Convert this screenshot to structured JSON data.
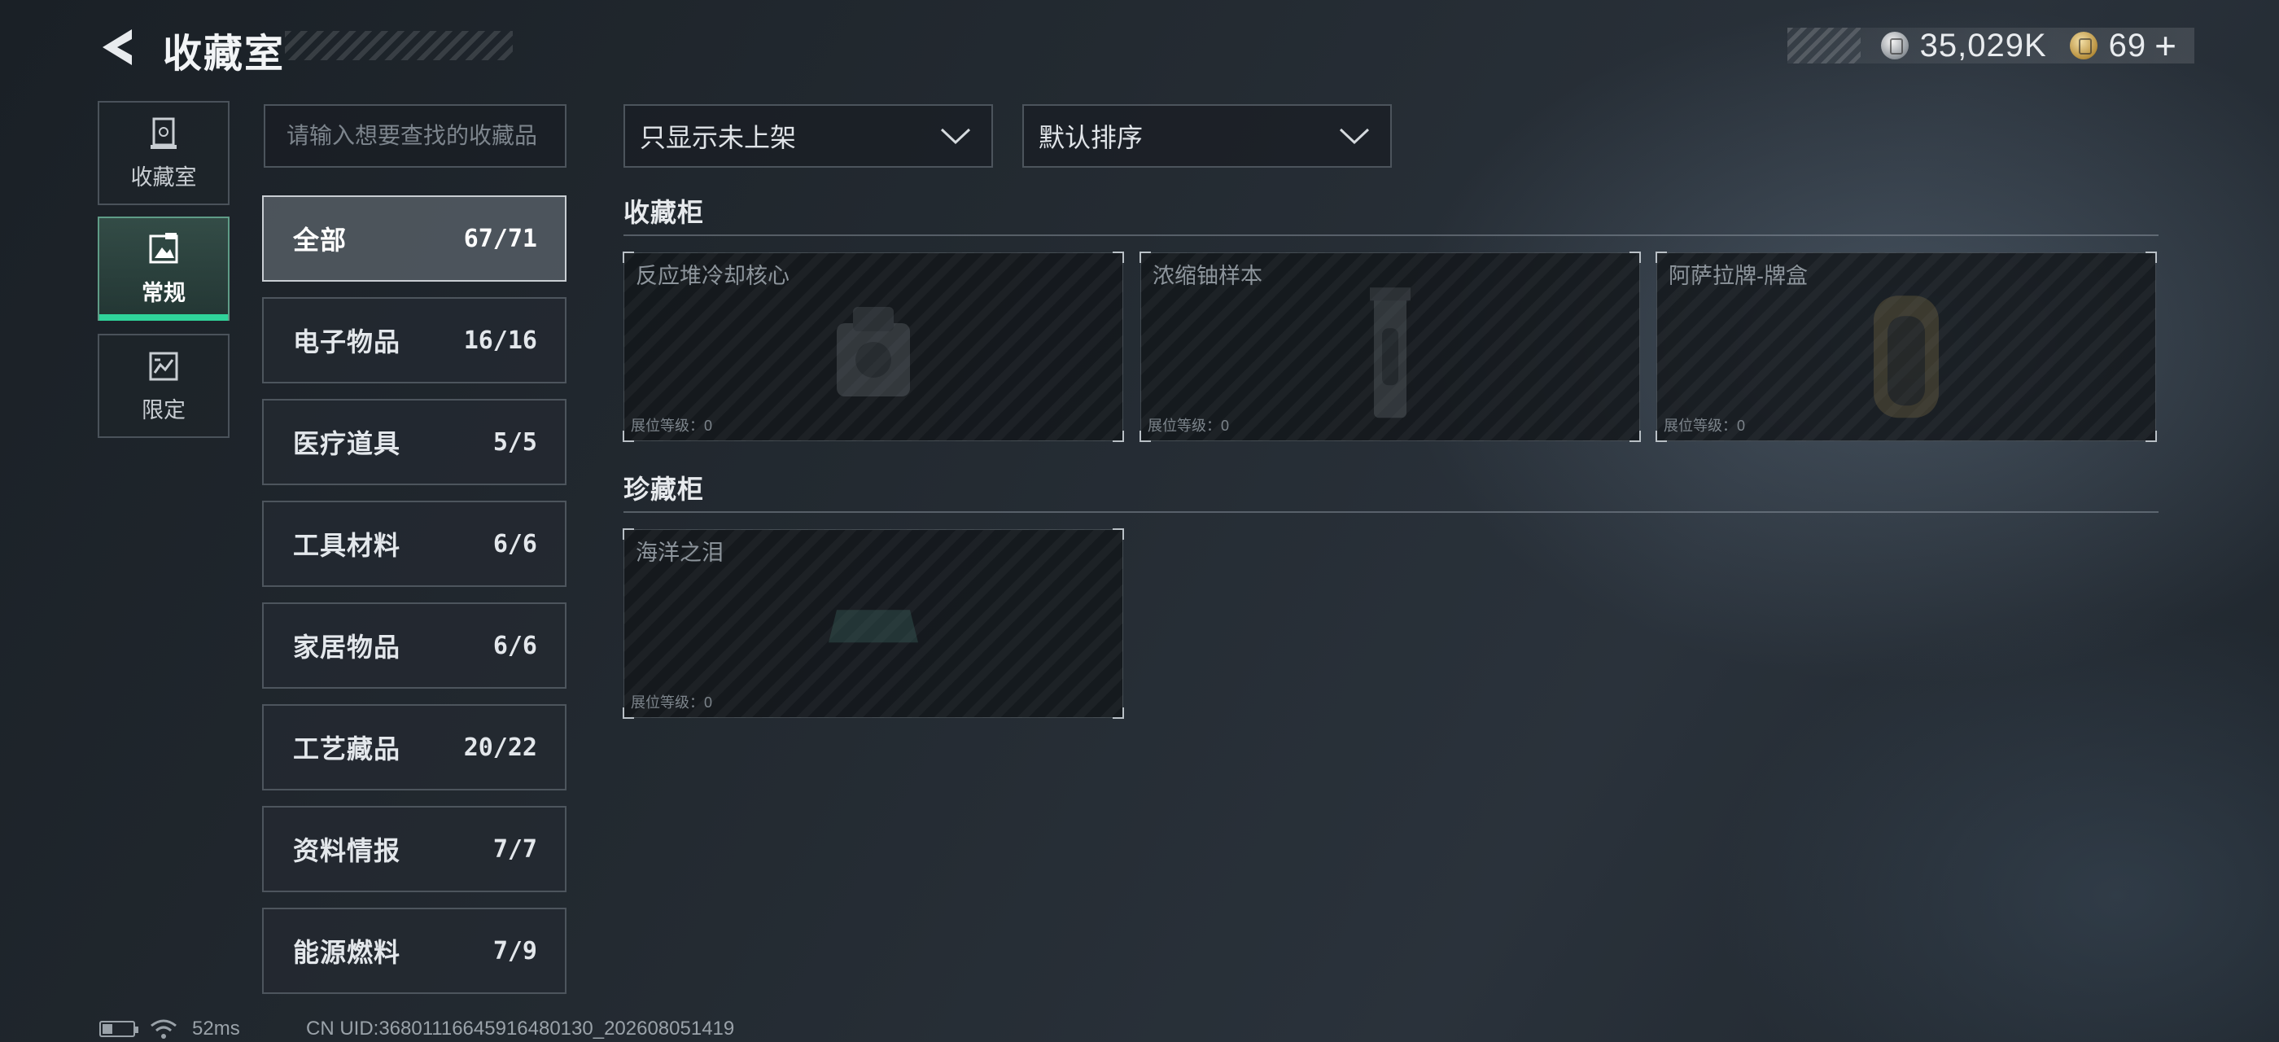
{
  "header": {
    "title": "收藏室",
    "currency_silver": "35,029K",
    "currency_gold": "69",
    "plus": "+"
  },
  "nav": {
    "items": [
      {
        "label": "收藏室",
        "icon": "display-case-icon"
      },
      {
        "label": "常规",
        "icon": "image-frame-icon"
      },
      {
        "label": "限定",
        "icon": "limited-frame-icon"
      }
    ]
  },
  "search": {
    "placeholder": "请输入想要查找的收藏品"
  },
  "categories": [
    {
      "name": "全部",
      "count": "67/71"
    },
    {
      "name": "电子物品",
      "count": "16/16"
    },
    {
      "name": "医疗道具",
      "count": "5/5"
    },
    {
      "name": "工具材料",
      "count": "6/6"
    },
    {
      "name": "家居物品",
      "count": "6/6"
    },
    {
      "name": "工艺藏品",
      "count": "20/22"
    },
    {
      "name": "资料情报",
      "count": "7/7"
    },
    {
      "name": "能源燃料",
      "count": "7/9"
    }
  ],
  "filters": {
    "display": "只显示未上架",
    "sort": "默认排序"
  },
  "sections": [
    {
      "title": "收藏柜",
      "cards": [
        {
          "name": "反应堆冷却核心",
          "level": "展位等级：0"
        },
        {
          "name": "浓缩铀样本",
          "level": "展位等级：0"
        },
        {
          "name": "阿萨拉牌-牌盒",
          "level": "展位等级：0"
        }
      ]
    },
    {
      "title": "珍藏柜",
      "cards": [
        {
          "name": "海洋之泪",
          "level": "展位等级：0"
        }
      ]
    }
  ],
  "footer": {
    "ping": "52ms",
    "uid": "CN UID:36801116645916480130_202608051419"
  },
  "colors": {
    "accent": "#2fd49a",
    "background": "#20272e"
  }
}
